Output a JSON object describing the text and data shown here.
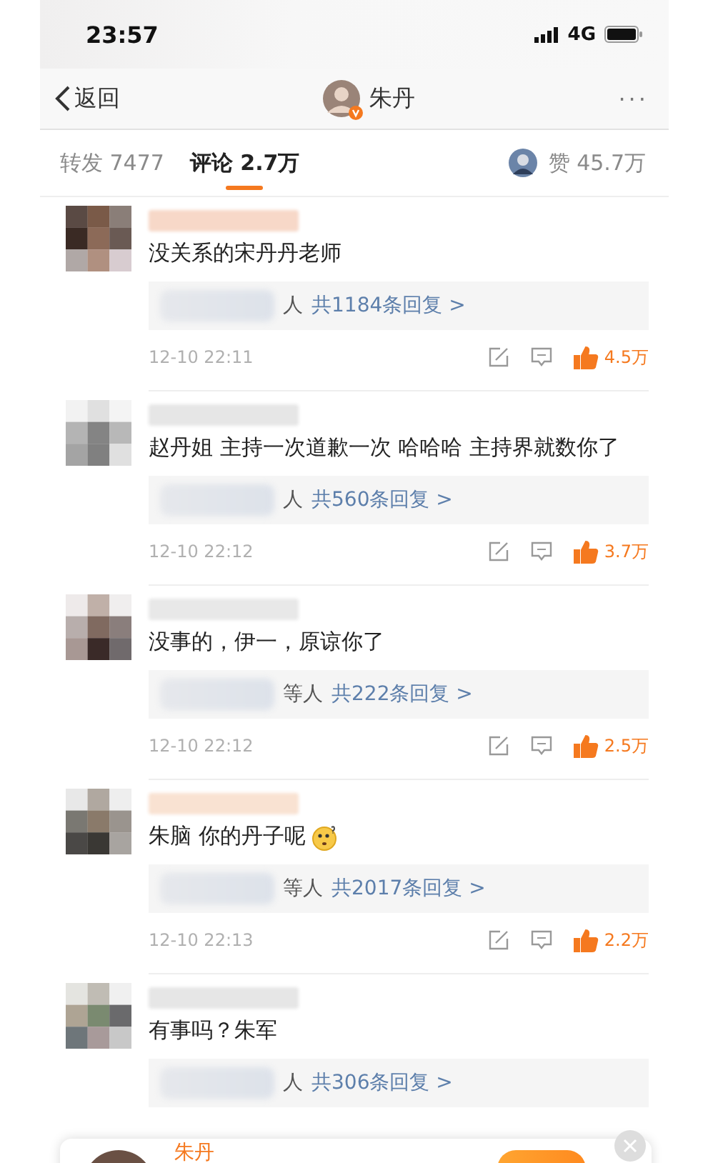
{
  "status_bar": {
    "time": "23:57",
    "network": "4G"
  },
  "nav": {
    "back": "返回",
    "title": "朱丹",
    "verified": true,
    "more": "···"
  },
  "tabs": [
    {
      "label": "转发 7477",
      "selected": false
    },
    {
      "label": "评论 2.7万",
      "selected": true
    }
  ],
  "likes_tab": {
    "label": "赞 45.7万"
  },
  "comments": [
    {
      "text": "没关系的宋丹丹老师",
      "emoji": false,
      "reply_prefix": "人",
      "reply_link": "共1184条回复 >",
      "time": "12-10 22:11",
      "likes": "4.5万",
      "liked": true
    },
    {
      "text": "赵丹姐  主持一次道歉一次   哈哈哈   主持界就数你了",
      "emoji": false,
      "reply_prefix": "人",
      "reply_link": "共560条回复 >",
      "time": "12-10 22:12",
      "likes": "3.7万",
      "liked": true
    },
    {
      "text": "没事的，伊一，原谅你了",
      "emoji": false,
      "reply_prefix": "等人",
      "reply_link": "共222条回复 >",
      "time": "12-10 22:12",
      "likes": "2.5万",
      "liked": true
    },
    {
      "text": "朱脑 你的丹子呢",
      "emoji": true,
      "reply_prefix": "等人",
      "reply_link": "共2017条回复 >",
      "time": "12-10 22:13",
      "likes": "2.2万",
      "liked": true
    },
    {
      "text": "有事吗？朱军",
      "emoji": false,
      "reply_prefix": "人",
      "reply_link": "共306条回复 >"
    }
  ],
  "popup": {
    "name": "朱丹"
  }
}
